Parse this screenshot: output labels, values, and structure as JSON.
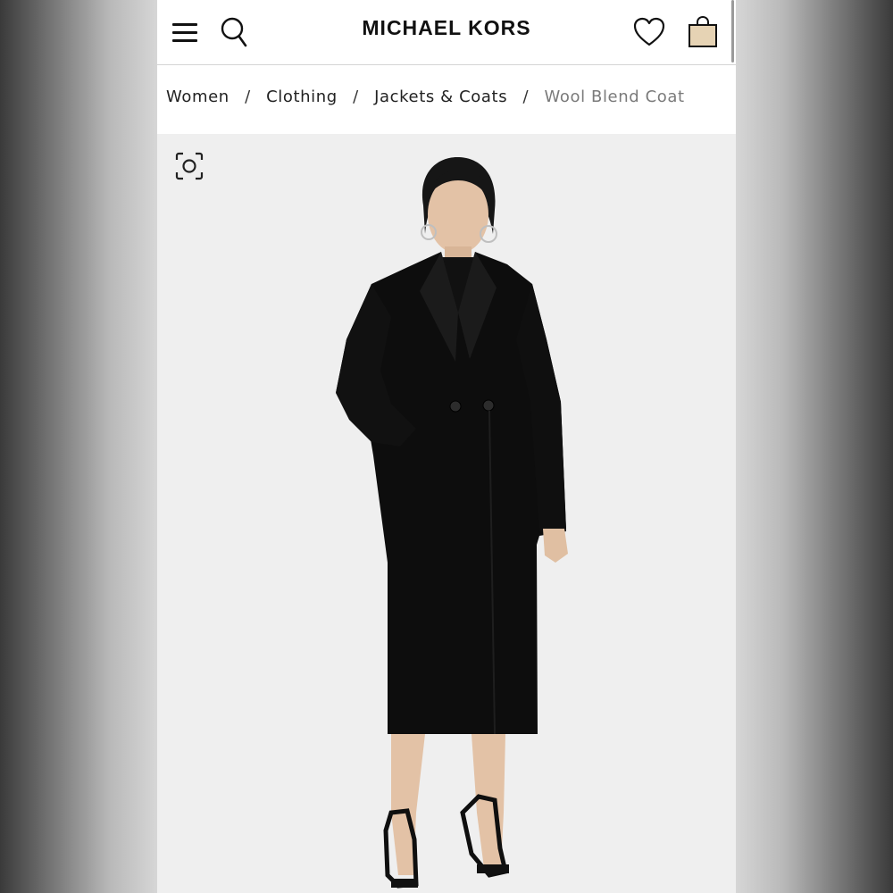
{
  "header": {
    "brand": "MICHAEL KORS",
    "icons": {
      "menu": "hamburger-menu-icon",
      "search": "search-icon",
      "wishlist": "heart-icon",
      "bag": "shopping-bag-icon"
    }
  },
  "breadcrumb": {
    "items": [
      "Women",
      "Clothing",
      "Jackets & Coats"
    ],
    "current": "Wool Blend Coat",
    "separator": "/"
  },
  "product_image": {
    "zoom_icon": "camera-scan-icon",
    "background": "#efefef",
    "coat_color": "#0d0d0d"
  },
  "colors": {
    "bag_fill": "#e6d3b4",
    "text_primary": "#111111",
    "text_muted": "#7a7a7a"
  }
}
